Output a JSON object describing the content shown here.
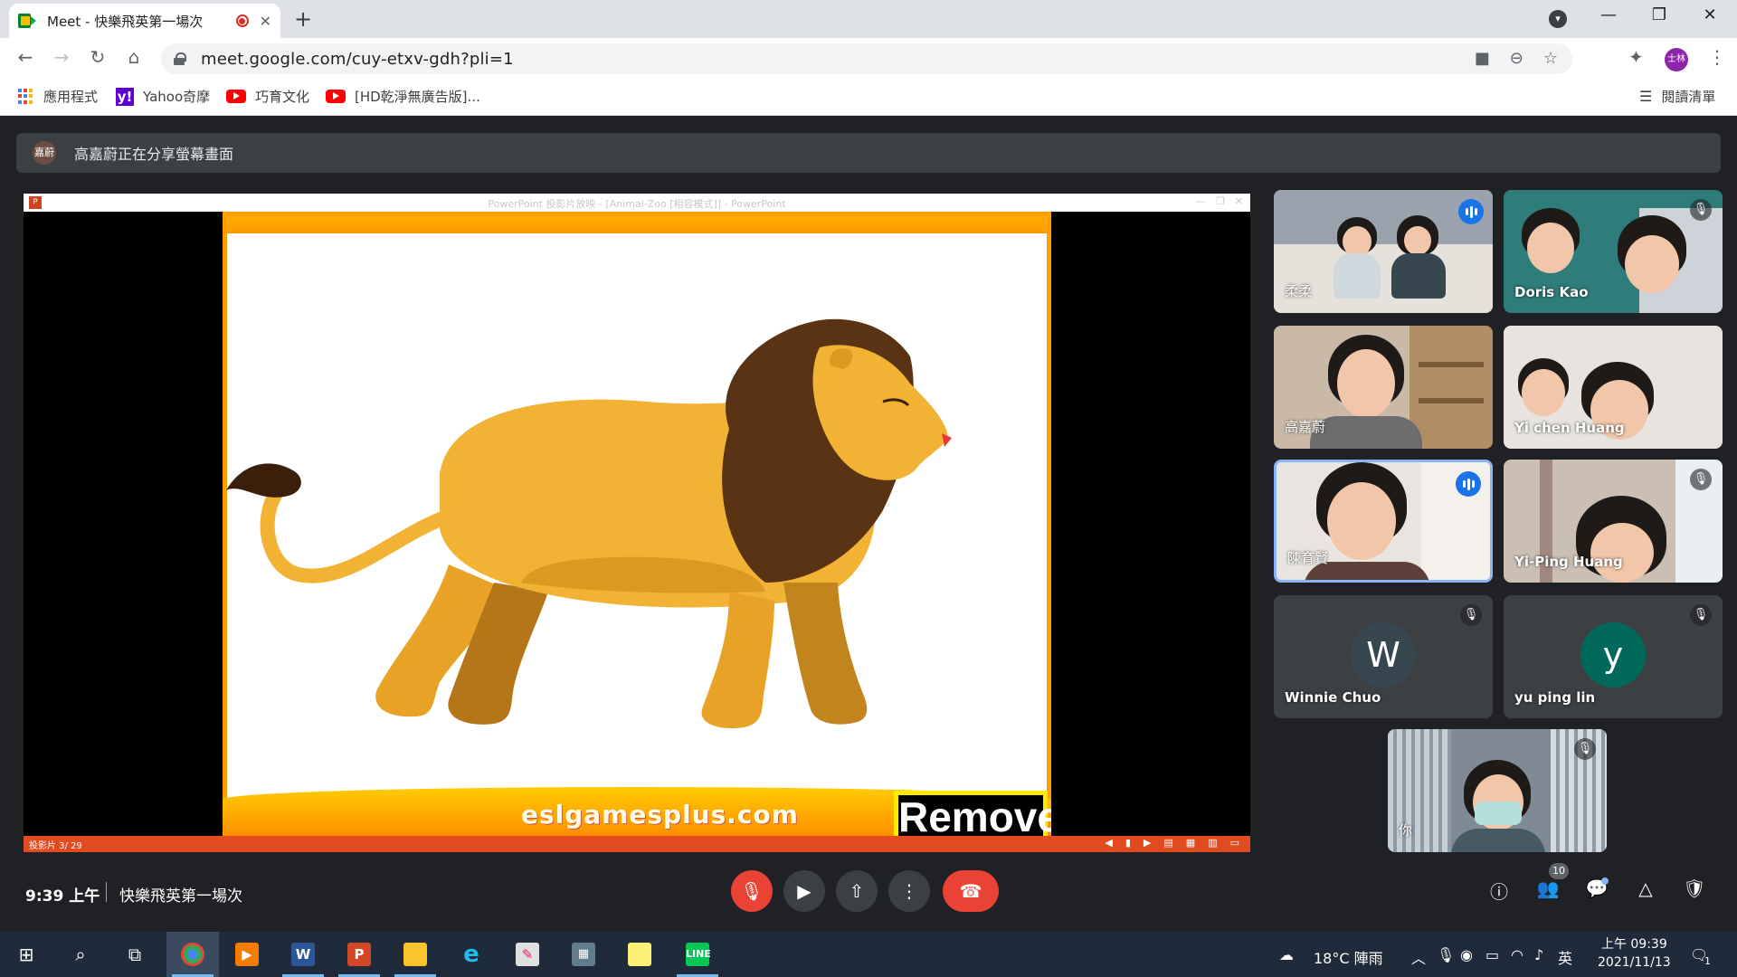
{
  "browser": {
    "tab_title": "Meet - 快樂飛英第一場次",
    "url": "meet.google.com/cuy-etxv-gdh?pli=1",
    "profile_initials": "士林",
    "bookmarks": [
      "應用程式",
      "Yahoo奇摩",
      "巧育文化",
      "[HD乾淨無廣告版]..."
    ],
    "reading_list": "閱讀清單"
  },
  "meet": {
    "presenter_avatar": "嘉蔚",
    "share_banner": "高嘉蔚正在分享螢幕畫面",
    "ppt": {
      "window_caption": "PowerPoint 投影片放映 - [Animal-Zoo [相容模式]] - PowerPoint",
      "slide_counter": "投影片 3/ 29",
      "site": "eslgamesplus.com",
      "button": "Remove"
    },
    "tiles": [
      {
        "name": "柔柔",
        "state": "speaking"
      },
      {
        "name": "Doris Kao",
        "state": "muted"
      },
      {
        "name": "高嘉蔚",
        "state": "none"
      },
      {
        "name": "Yi chen Huang",
        "state": "none"
      },
      {
        "name": "陳育賢",
        "state": "speaking"
      },
      {
        "name": "Yi-Ping Huang",
        "state": "muted"
      },
      {
        "name": "Winnie Chuo",
        "letter": "W",
        "color": "#37474f",
        "state": "muted"
      },
      {
        "name": "yu ping lin",
        "letter": "y",
        "color": "#00695c",
        "state": "muted"
      },
      {
        "name": "你",
        "state": "muted"
      }
    ],
    "time": "9:39 上午",
    "meeting_name": "快樂飛英第一場次",
    "people_count": "10"
  },
  "taskbar": {
    "weather": "18°C 陣雨",
    "ime": "英",
    "clock_time": "上午 09:39",
    "clock_date": "2021/11/13",
    "notif_count": "1"
  },
  "colors": {
    "meet_bg": "#202124",
    "tile_bg": "#3c4043",
    "end_call": "#ea4335",
    "accent": "#1a73e8"
  }
}
